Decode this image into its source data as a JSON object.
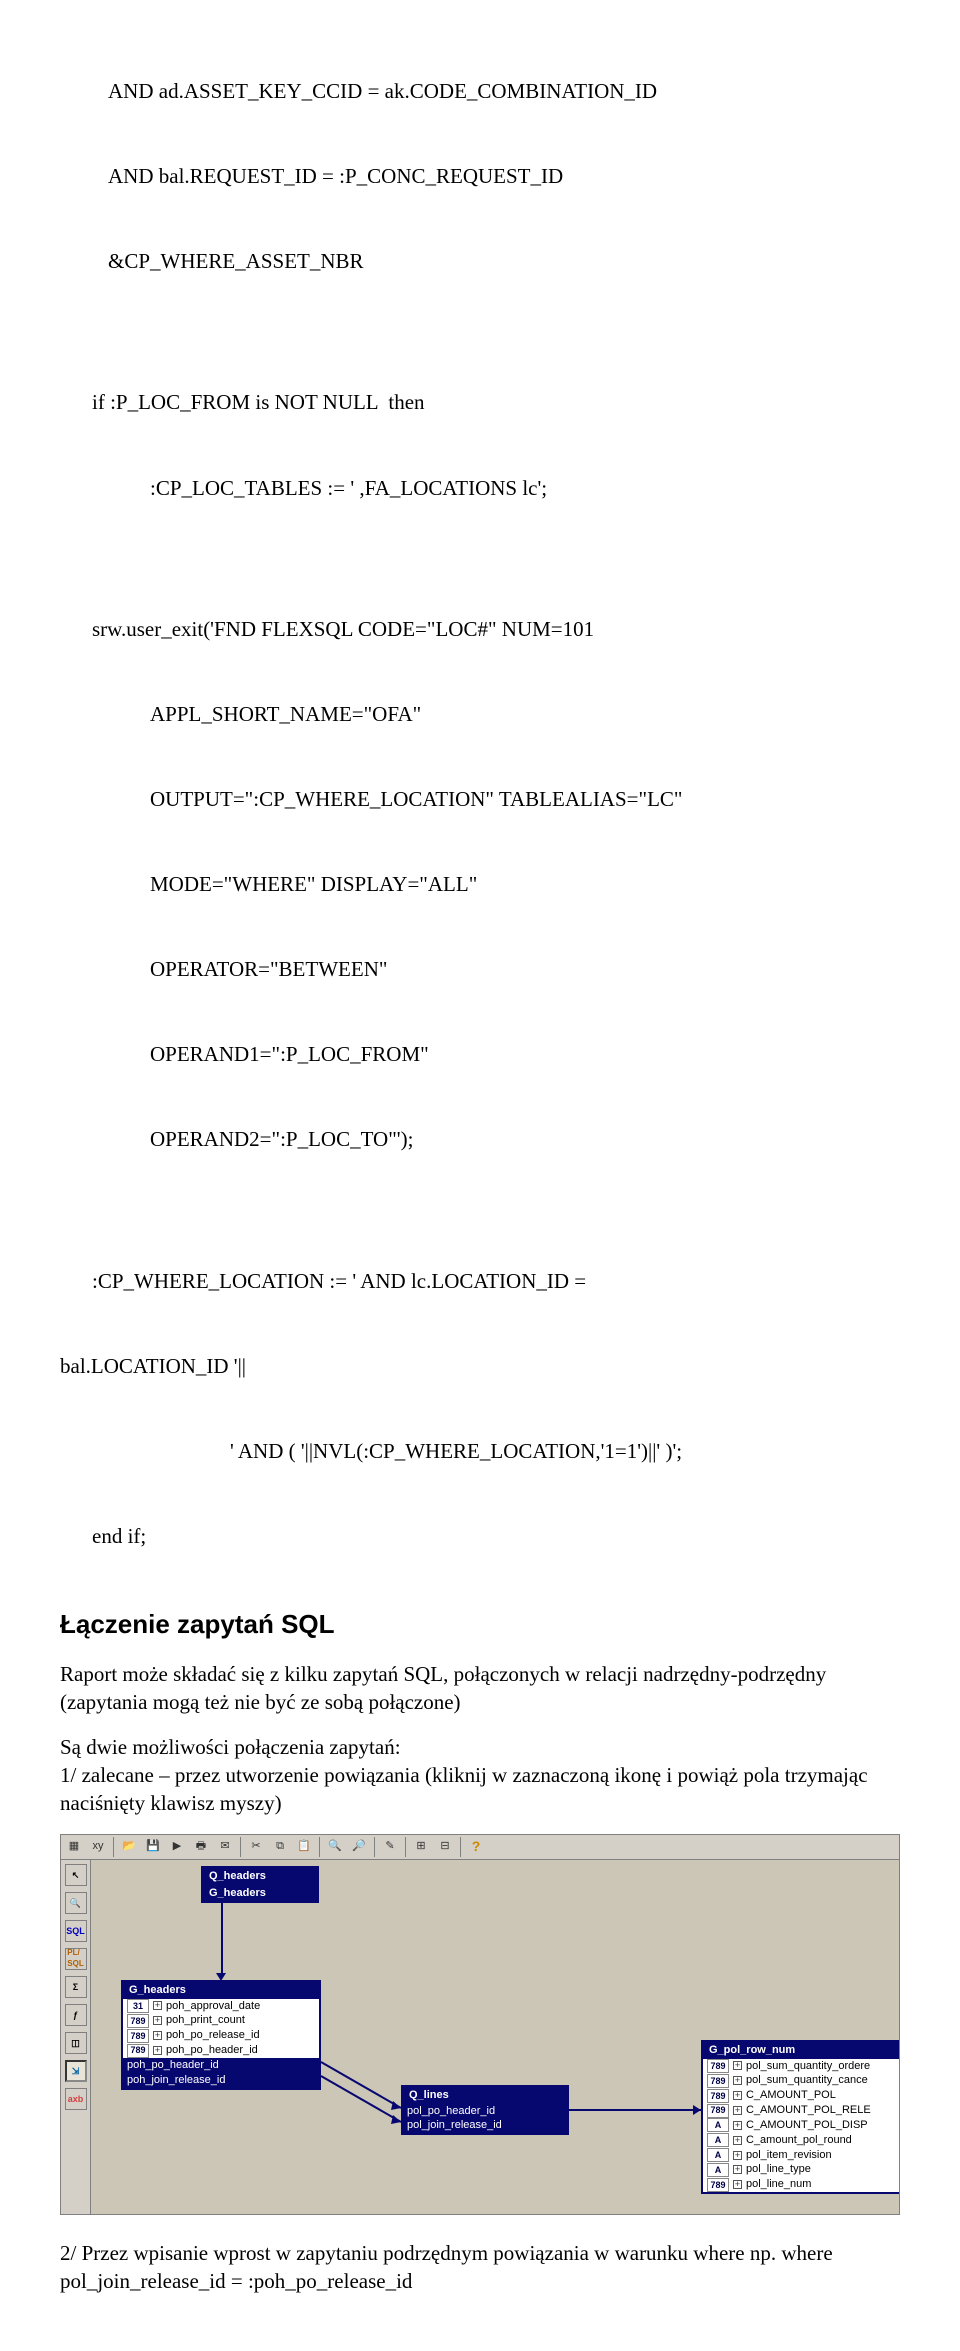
{
  "code": {
    "l1": "AND ad.ASSET_KEY_CCID = ak.CODE_COMBINATION_ID",
    "l2": "AND bal.REQUEST_ID = :P_CONC_REQUEST_ID",
    "l3": "&CP_WHERE_ASSET_NBR",
    "l4": "if :P_LOC_FROM is NOT NULL  then",
    "l5": ":CP_LOC_TABLES := ' ,FA_LOCATIONS lc';",
    "l6": "srw.user_exit('FND FLEXSQL CODE=\"LOC#\" NUM=101",
    "l7": "APPL_SHORT_NAME=\"OFA\"",
    "l8": "OUTPUT=\":CP_WHERE_LOCATION\" TABLEALIAS=\"LC\"",
    "l9": "MODE=\"WHERE\" DISPLAY=\"ALL\"",
    "l10": "OPERATOR=\"BETWEEN\"",
    "l11": "OPERAND1=\":P_LOC_FROM\"",
    "l12": "OPERAND2=\":P_LOC_TO\"');",
    "l13": ":CP_WHERE_LOCATION := ' AND lc.LOCATION_ID =",
    "l14": "bal.LOCATION_ID '||",
    "l15": "' AND ( '||NVL(:CP_WHERE_LOCATION,'1=1')||' )';",
    "l16": "end if;"
  },
  "h2": "Łączenie zapytań SQL",
  "p1": "Raport może składać się z kilku zapytań SQL, połączonych w relacji nadrzędny-podrzędny (zapytania mogą też nie być ze sobą połączone)",
  "p2a": "Są dwie możliwości połączenia zapytań:",
  "p2b": "1/ zalecane – przez utworzenie powiązania (kliknij w zaznaczoną ikonę i powiąż pola trzymając naciśnięty klawisz myszy)",
  "p3": "2/ Przez wpisanie wprost w zapytaniu podrzędnym powiązania w warunku where np. where pol_join_release_id = :poh_po_release_id",
  "toolbar": {
    "help_glyph": "?"
  },
  "diagram": {
    "q_headers": {
      "title": "Q_headers",
      "sub": "G_headers"
    },
    "g_headers": {
      "title": "G_headers",
      "rows": [
        {
          "type": "31",
          "label": "poh_approval_date"
        },
        {
          "type": "789",
          "label": "poh_print_count"
        },
        {
          "type": "789",
          "label": "poh_po_release_id"
        },
        {
          "type": "789",
          "label": "poh_po_header_id"
        },
        {
          "type": "hi",
          "label": "poh_po_header_id"
        },
        {
          "type": "hi",
          "label": "poh_join_release_id"
        }
      ]
    },
    "q_lines": {
      "title": "Q_lines",
      "rows": [
        {
          "type": "hi",
          "label": "pol_po_header_id"
        },
        {
          "type": "hi",
          "label": "pol_join_release_id"
        }
      ]
    },
    "g_pol": {
      "title": "G_pol_row_num",
      "rows": [
        {
          "type": "789",
          "label": "pol_sum_quantity_ordere"
        },
        {
          "type": "789",
          "label": "pol_sum_quantity_cance"
        },
        {
          "type": "789",
          "label": "C_AMOUNT_POL"
        },
        {
          "type": "789",
          "label": "C_AMOUNT_POL_RELE"
        },
        {
          "type": "A",
          "label": "C_AMOUNT_POL_DISP"
        },
        {
          "type": "A",
          "label": "C_amount_pol_round"
        },
        {
          "type": "A",
          "label": "pol_item_revision"
        },
        {
          "type": "A",
          "label": "pol_line_type"
        },
        {
          "type": "789",
          "label": "pol_line_num"
        }
      ]
    }
  }
}
